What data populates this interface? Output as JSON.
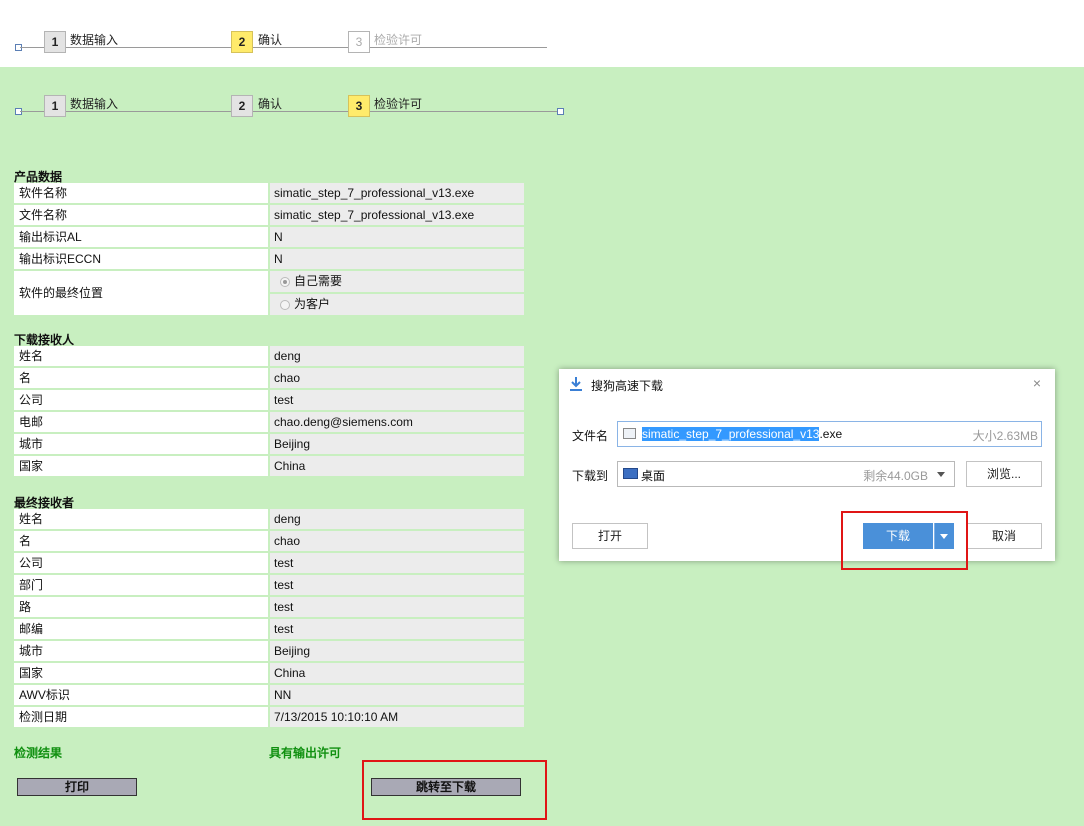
{
  "steps_top": [
    {
      "num": "1",
      "label": "数据输入",
      "state": "done"
    },
    {
      "num": "2",
      "label": "确认",
      "state": "active"
    },
    {
      "num": "3",
      "label": "检验许可",
      "state": "future"
    }
  ],
  "steps_main": [
    {
      "num": "1",
      "label": "数据输入",
      "state": "done"
    },
    {
      "num": "2",
      "label": "确认",
      "state": "done"
    },
    {
      "num": "3",
      "label": "检验许可",
      "state": "active"
    }
  ],
  "product": {
    "title": "产品数据",
    "rows": [
      {
        "label": "软件名称",
        "value": "simatic_step_7_professional_v13.exe"
      },
      {
        "label": "文件名称",
        "value": "simatic_step_7_professional_v13.exe"
      },
      {
        "label": "输出标识AL",
        "value": "N"
      },
      {
        "label": "输出标识ECCN",
        "value": "N"
      }
    ],
    "destination_label": "软件的最终位置",
    "destination_options": [
      {
        "label": "自己需要",
        "selected": true
      },
      {
        "label": "为客户",
        "selected": false
      }
    ]
  },
  "recipient": {
    "title": "下载接收人",
    "rows": [
      {
        "label": "姓名",
        "value": "deng"
      },
      {
        "label": "名",
        "value": "chao"
      },
      {
        "label": "公司",
        "value": "test"
      },
      {
        "label": "电邮",
        "value": "chao.deng@siemens.com"
      },
      {
        "label": "城市",
        "value": "Beijing"
      },
      {
        "label": "国家",
        "value": "China"
      }
    ]
  },
  "final_recipient": {
    "title": "最终接收者",
    "rows": [
      {
        "label": "姓名",
        "value": "deng"
      },
      {
        "label": "名",
        "value": "chao"
      },
      {
        "label": "公司",
        "value": "test"
      },
      {
        "label": "部门",
        "value": "test"
      },
      {
        "label": "路",
        "value": "test"
      },
      {
        "label": "邮编",
        "value": "test"
      },
      {
        "label": "城市",
        "value": "Beijing"
      },
      {
        "label": "国家",
        "value": "China"
      },
      {
        "label": "AWV标识",
        "value": "NN"
      },
      {
        "label": "检测日期",
        "value": "7/13/2015 10:10:10 AM"
      }
    ]
  },
  "result": {
    "label": "检测结果",
    "value": "具有输出许可"
  },
  "actions": {
    "print": "打印",
    "goto_download": "跳转至下载"
  },
  "dialog": {
    "title": "搜狗高速下载",
    "filename_label": "文件名",
    "filename_selected": "simatic_step_7_professional_v13",
    "filename_ext": ".exe",
    "size": "大小2.63MB",
    "saveto_label": "下载到",
    "folder": "桌面",
    "free_space": "剩余44.0GB",
    "browse": "浏览...",
    "open": "打开",
    "download": "下载",
    "cancel": "取消",
    "colors": {
      "primary": "#4a90d9",
      "highlight": "#3399ff"
    }
  }
}
